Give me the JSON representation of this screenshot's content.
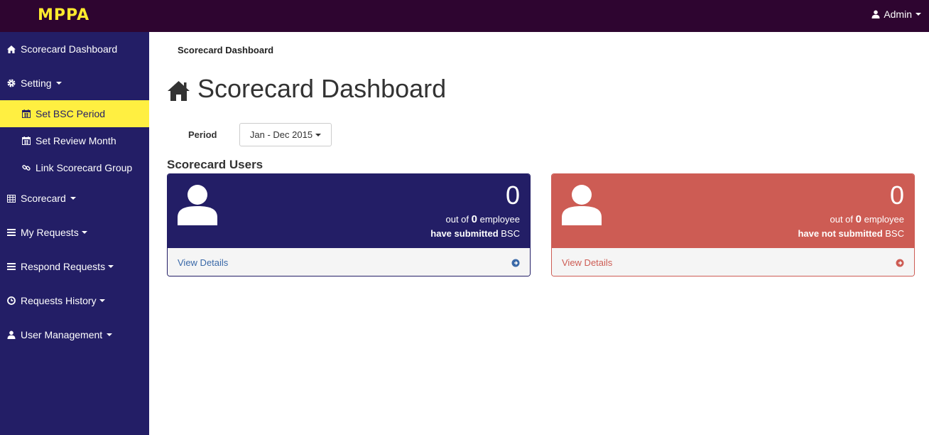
{
  "app": {
    "brand": "MPPA"
  },
  "topbar": {
    "user_label": "Admin"
  },
  "sidebar": {
    "items": [
      {
        "label": "Scorecard Dashboard"
      },
      {
        "label": "Setting"
      },
      {
        "label": "Set BSC Period"
      },
      {
        "label": "Set Review Month"
      },
      {
        "label": "Link Scorecard Group"
      },
      {
        "label": "Scorecard"
      },
      {
        "label": "My Requests"
      },
      {
        "label": "Respond Requests"
      },
      {
        "label": "Requests History"
      },
      {
        "label": "User Management"
      }
    ],
    "active_item": "Set BSC Period"
  },
  "main": {
    "breadcrumb": "Scorecard Dashboard",
    "title": "Scorecard Dashboard",
    "period": {
      "label": "Period",
      "value": "Jan - Dec 2015"
    },
    "section_title": "Scorecard Users",
    "panels": [
      {
        "count": "0",
        "prefix": "out of",
        "total": "0",
        "suffix": "employee",
        "status_bold": "have submitted",
        "status_tail": "BSC",
        "footer": "View Details"
      },
      {
        "count": "0",
        "prefix": "out of",
        "total": "0",
        "suffix": "employee",
        "status_bold": "have not submitted",
        "status_tail": "BSC",
        "footer": "View Details"
      }
    ]
  },
  "colors": {
    "topbar": "#2e0530",
    "brand": "#ffea2e",
    "sidebar": "#231e66",
    "sidebar_active": "#ffef41",
    "panel_submitted": "#231e66",
    "panel_not_submitted": "#cd5c54",
    "link": "#3a69a8"
  }
}
